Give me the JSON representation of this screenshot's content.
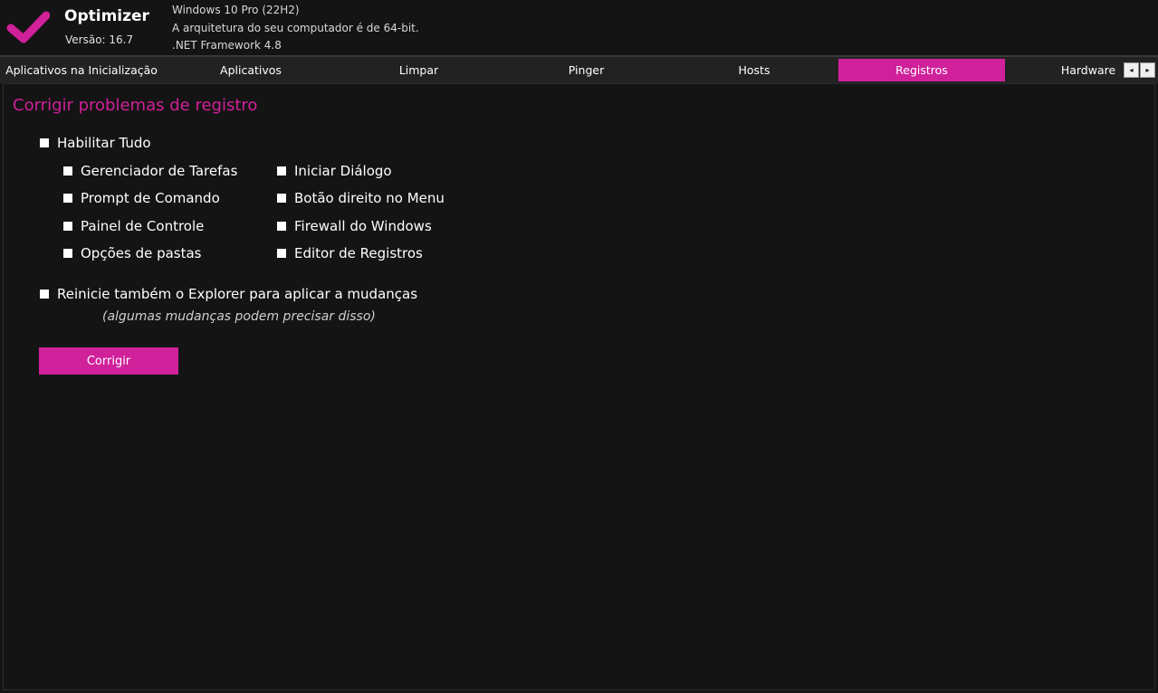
{
  "app": {
    "title": "Optimizer",
    "version": "Versão: 16.7",
    "accent": "#d0209a",
    "logo_icon": "checkmark-icon"
  },
  "system_info": {
    "os": "Windows 10 Pro (22H2)",
    "architecture": "A arquitetura do seu computador é de 64-bit.",
    "framework": ".NET Framework 4.8"
  },
  "tabs": [
    {
      "label": "Aplicativos na Inicialização",
      "active": false
    },
    {
      "label": "Aplicativos",
      "active": false
    },
    {
      "label": "Limpar",
      "active": false
    },
    {
      "label": "Pinger",
      "active": false
    },
    {
      "label": "Hosts",
      "active": false
    },
    {
      "label": "Registros",
      "active": true
    },
    {
      "label": "Hardware",
      "active": false
    }
  ],
  "tab_scroll": {
    "left": "◂",
    "right": "▸"
  },
  "registry": {
    "title": "Corrigir problemas de registro",
    "enable_all": "Habilitar Tudo",
    "options_left": [
      "Gerenciador de Tarefas",
      "Prompt de Comando",
      "Painel de Controle",
      "Opções de pastas"
    ],
    "options_right": [
      "Iniciar Diálogo",
      "Botão direito no Menu",
      "Firewall do Windows",
      "Editor de Registros"
    ],
    "restart_explorer": "Reinicie também o Explorer para aplicar a mudanças",
    "hint": "(algumas mudanças podem precisar disso)",
    "fix_button": "Corrigir"
  }
}
